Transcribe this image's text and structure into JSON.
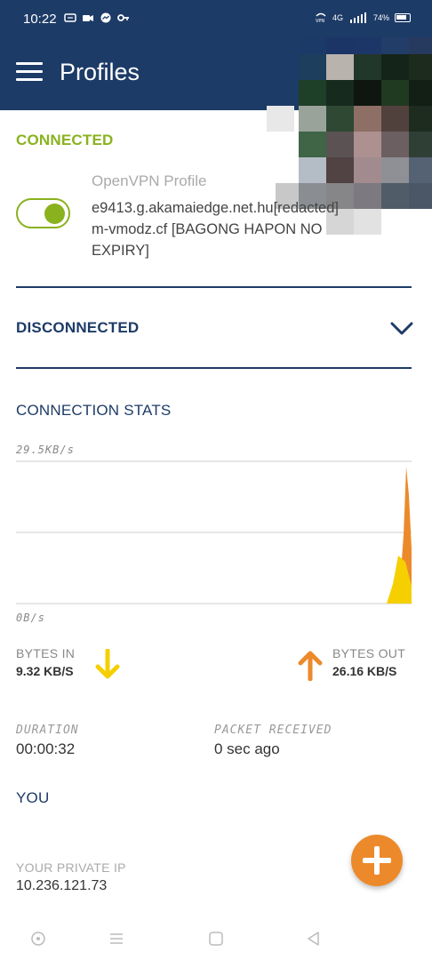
{
  "status_bar": {
    "time": "10:22",
    "network": "4G",
    "battery": "74%",
    "icons": [
      "message-icon",
      "video-icon",
      "messenger-icon",
      "key-icon",
      "vpn-icon",
      "signal-icon",
      "battery-icon"
    ]
  },
  "app_bar": {
    "title": "Profiles",
    "menu_icon": "hamburger-menu-icon"
  },
  "connected_section": {
    "heading": "CONNECTED",
    "profile_type": "OpenVPN Profile",
    "profile_name": "e9413.g.akamaiedge.net.hu[redacted] m-vmodz.cf [BAGONG HAPON NO EXPIRY]",
    "toggle_on": true
  },
  "disconnected_section": {
    "heading": "DISCONNECTED",
    "icon": "chevron-down-icon"
  },
  "stats": {
    "heading": "CONNECTION STATS",
    "chart_max_label": "29.5KB/s",
    "chart_min_label": "0B/s",
    "bytes_in_label": "BYTES IN",
    "bytes_in_value": "9.32 KB/S",
    "bytes_out_label": "BYTES OUT",
    "bytes_out_value": "26.16 KB/S",
    "duration_label": "DURATION",
    "duration_value": "00:00:32",
    "packet_label": "PACKET RECEIVED",
    "packet_value": "0 sec ago"
  },
  "you_section": {
    "heading": "YOU",
    "private_ip_label": "YOUR PRIVATE IP",
    "private_ip_value": "10.236.121.73"
  },
  "colors": {
    "primary": "#1d3b67",
    "accent_green": "#8ab21f",
    "bytes_in": "#f5cf00",
    "bytes_out": "#ec8a2b"
  },
  "fab_icon": "add-icon",
  "nav_icons": [
    "circle-nav-icon",
    "menu-nav-icon",
    "home-nav-icon",
    "back-nav-icon"
  ]
}
